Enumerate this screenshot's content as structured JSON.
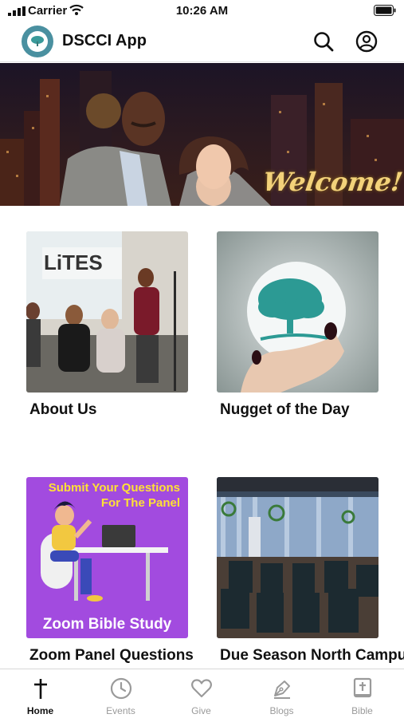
{
  "status_bar": {
    "carrier": "Carrier",
    "time": "10:26 AM"
  },
  "header": {
    "title": "DSCCI App"
  },
  "banner": {
    "welcome_text": "Welcome!"
  },
  "tiles": [
    {
      "label": "About Us"
    },
    {
      "label": "Nugget of the Day"
    },
    {
      "label": "Zoom Panel Questions",
      "image_top_text_1": "Submit Your Questions",
      "image_top_text_2": "For The Panel",
      "image_bottom_text": "Zoom Bible Study"
    },
    {
      "label": "Due Season North Campus"
    }
  ],
  "tabs": [
    {
      "label": "Home",
      "icon": "cross-icon",
      "active": true
    },
    {
      "label": "Events",
      "icon": "clock-icon"
    },
    {
      "label": "Give",
      "icon": "heart-icon"
    },
    {
      "label": "Blogs",
      "icon": "pen-icon"
    },
    {
      "label": "Bible",
      "icon": "bible-icon"
    }
  ],
  "colors": {
    "zoom_bg": "#a24bdf",
    "zoom_title": "#ffe135",
    "tab_active": "#111111",
    "tab_inactive": "#9a9a9a"
  }
}
